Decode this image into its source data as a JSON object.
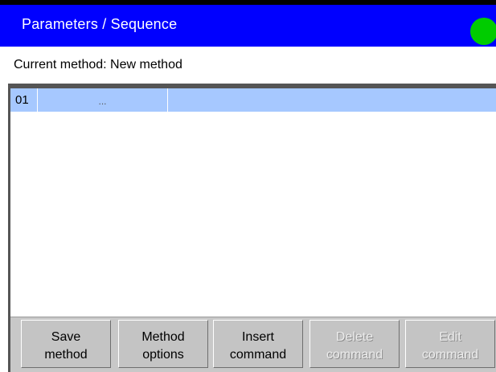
{
  "window": {
    "title": "Parameters / Sequence",
    "status_color": "#00cc00"
  },
  "method": {
    "label_text": "Current method: New method"
  },
  "sequence": {
    "rows": [
      {
        "number": "01",
        "command": "..."
      }
    ]
  },
  "toolbar": {
    "buttons": [
      {
        "line1": "Save",
        "line2": "method",
        "enabled": true
      },
      {
        "line1": "Method",
        "line2": "options",
        "enabled": true
      },
      {
        "line1": "Insert",
        "line2": "command",
        "enabled": true
      },
      {
        "line1": "Delete",
        "line2": "command",
        "enabled": false
      },
      {
        "line1": "Edit",
        "line2": "command",
        "enabled": false
      }
    ]
  },
  "colors": {
    "titlebar": "#0000ff",
    "selected_row": "#a6c8ff",
    "toolbar": "#c8c8c8"
  }
}
